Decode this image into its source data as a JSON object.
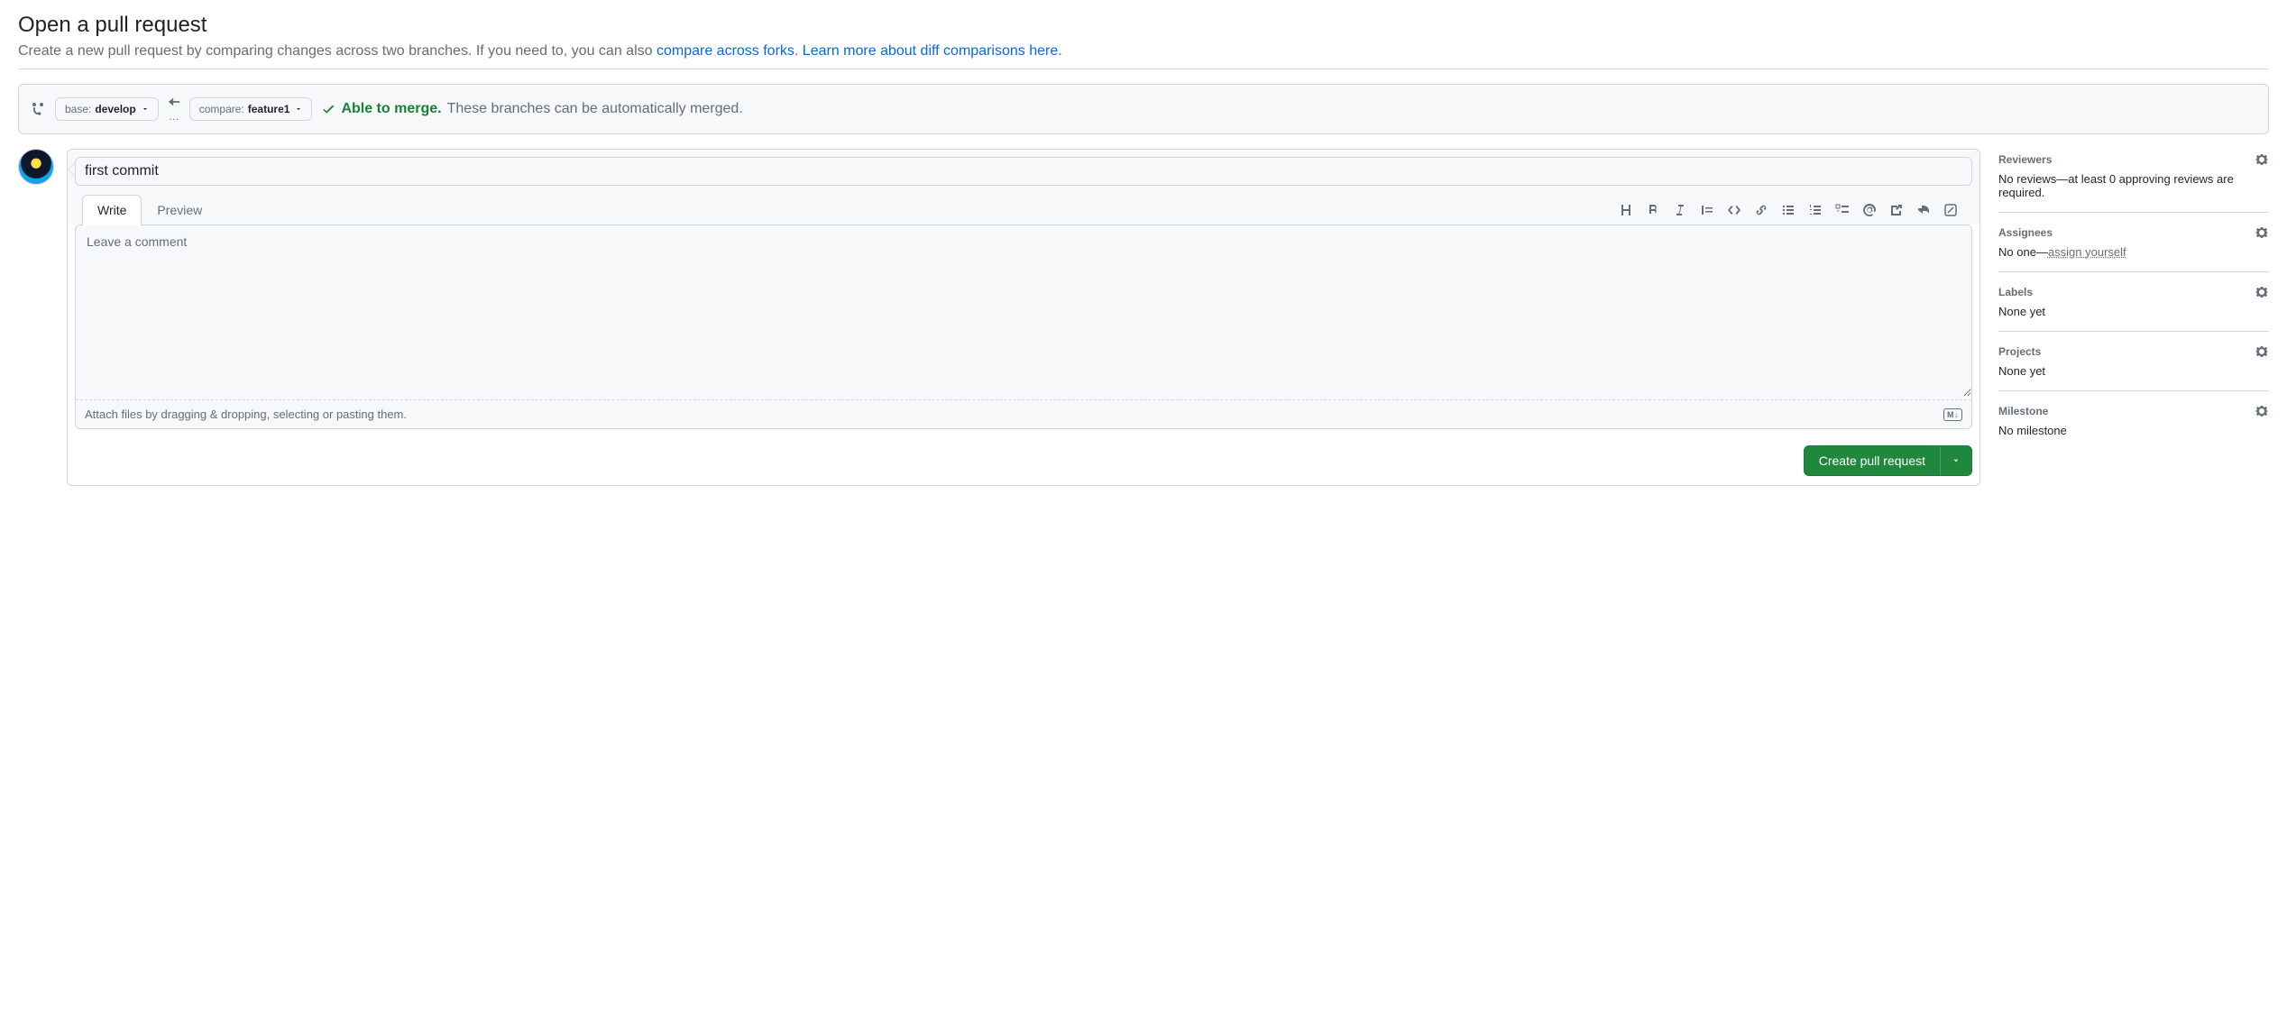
{
  "header": {
    "title": "Open a pull request",
    "subtitle_pre": "Create a new pull request by comparing changes across two branches. If you need to, you can also ",
    "subtitle_link1": "compare across forks",
    "subtitle_mid": ". ",
    "subtitle_link2": "Learn more about diff comparisons here.",
    "subtitle_end": ""
  },
  "range": {
    "base_label": "base: ",
    "base_value": "develop",
    "compare_label": "compare: ",
    "compare_value": "feature1",
    "merge_ok": "Able to merge.",
    "merge_msg": "These branches can be automatically merged."
  },
  "pr": {
    "title_value": "first commit",
    "tab_write": "Write",
    "tab_preview": "Preview",
    "comment_placeholder": "Leave a comment",
    "attach_hint": "Attach files by dragging & dropping, selecting or pasting them.",
    "markdown_badge": "M↓",
    "submit_label": "Create pull request"
  },
  "sidebar": {
    "reviewers": {
      "title": "Reviewers",
      "body": "No reviews—at least 0 approving reviews are required."
    },
    "assignees": {
      "title": "Assignees",
      "body_pre": "No one—",
      "assign_self": "assign yourself"
    },
    "labels": {
      "title": "Labels",
      "body": "None yet"
    },
    "projects": {
      "title": "Projects",
      "body": "None yet"
    },
    "milestone": {
      "title": "Milestone",
      "body": "No milestone"
    }
  }
}
